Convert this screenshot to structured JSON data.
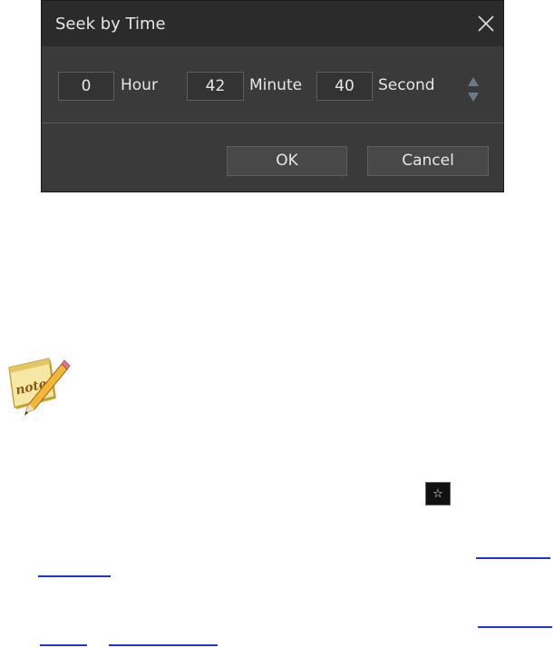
{
  "dialog": {
    "title": "Seek by Time",
    "close_icon": "close-icon",
    "hour": {
      "value": "0",
      "label": "Hour"
    },
    "minute": {
      "value": "42",
      "label": "Minute"
    },
    "second": {
      "value": "40",
      "label": "Second"
    },
    "spinner_icons": [
      "chevron-up-icon",
      "chevron-down-icon"
    ],
    "ok_label": "OK",
    "cancel_label": "Cancel"
  },
  "note": {
    "icon": "note-pencil-icon",
    "logo_text": "note"
  },
  "inline_icon": {
    "icon": "star-icon",
    "glyph": "☆"
  },
  "colors": {
    "dialog_bg": "#3a3a3a",
    "titlebar_bg": "#2b2b2b",
    "text": "#e6e6e6",
    "link": "#2233cc"
  }
}
